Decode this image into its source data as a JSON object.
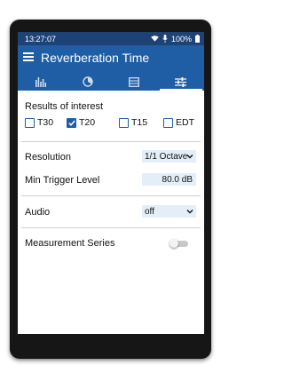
{
  "status_bar": {
    "time": "13:27:07",
    "battery": "100%"
  },
  "app_bar": {
    "title": "Reverberation Time"
  },
  "tabs": [
    {
      "icon": "bar-chart-icon"
    },
    {
      "icon": "dial-chart-icon"
    },
    {
      "icon": "table-icon"
    },
    {
      "icon": "settings-sliders-icon",
      "active": true
    }
  ],
  "results": {
    "title": "Results of interest",
    "options": [
      {
        "label": "T30",
        "checked": false
      },
      {
        "label": "T20",
        "checked": true
      },
      {
        "label": "T15",
        "checked": false
      },
      {
        "label": "EDT",
        "checked": false
      }
    ]
  },
  "settings": {
    "resolution_label": "Resolution",
    "resolution_value": "1/1 Octave",
    "min_trigger_label": "Min Trigger Level",
    "min_trigger_value": "80.0 dB",
    "audio_label": "Audio",
    "audio_value": "off",
    "series_label": "Measurement Series",
    "series_enabled": false
  },
  "colors": {
    "status_bar": "#1d4275",
    "app_bar": "#1f5da4",
    "field_bg": "#e4eef9",
    "device_frame": "#161616"
  }
}
